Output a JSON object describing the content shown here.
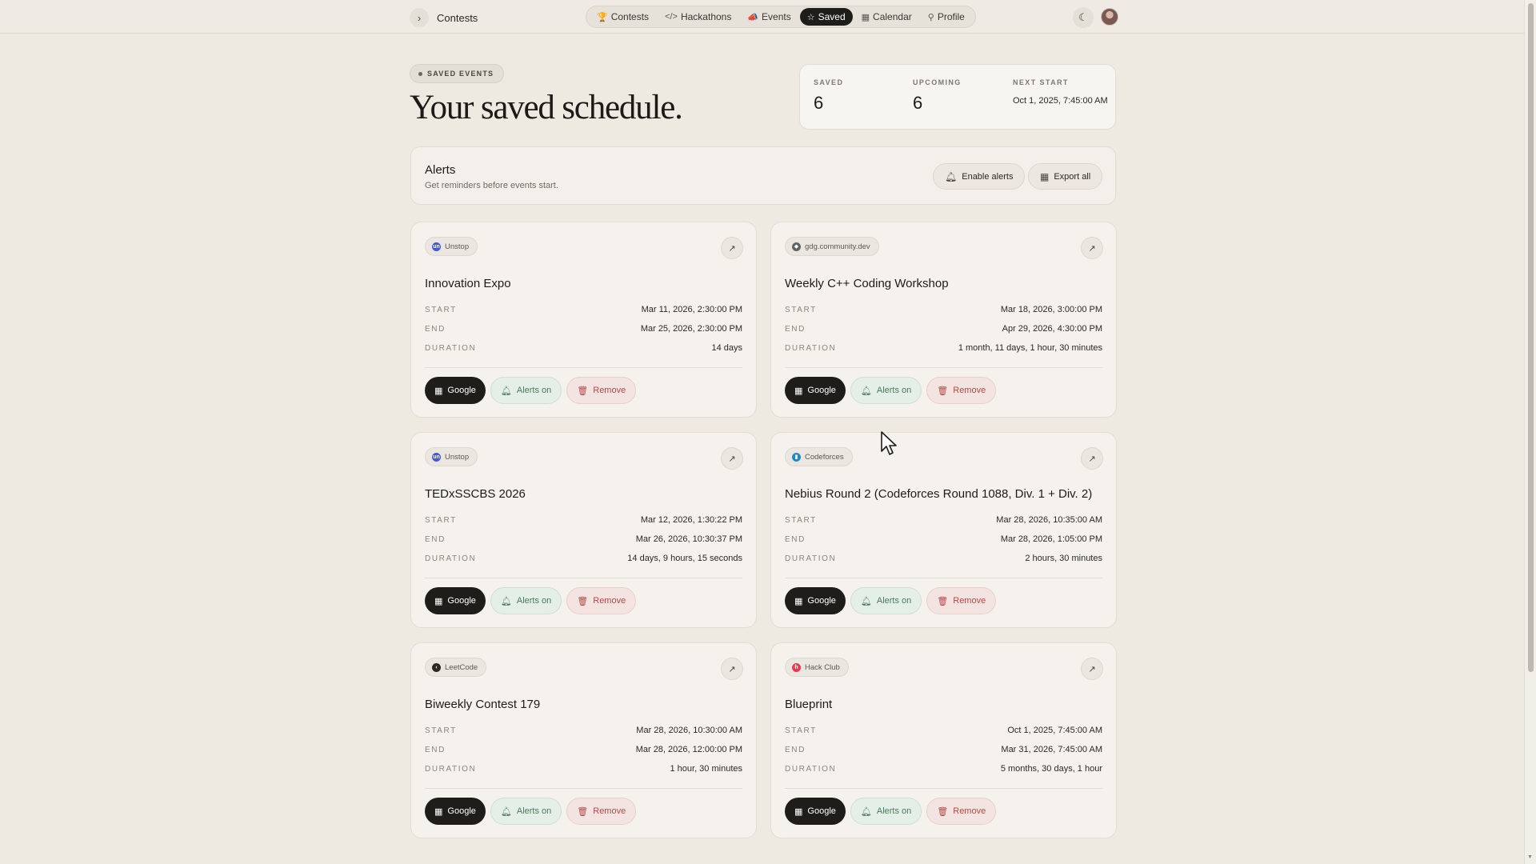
{
  "header": {
    "breadcrumb": "Contests",
    "nav": [
      {
        "icon": "trophy-icon",
        "glyph": "🏆",
        "label": "Contests",
        "active": false
      },
      {
        "icon": "code-icon",
        "glyph": "</>",
        "label": "Hackathons",
        "active": false
      },
      {
        "icon": "megaphone-icon",
        "glyph": "📣",
        "label": "Events",
        "active": false
      },
      {
        "icon": "star-icon",
        "glyph": "☆",
        "label": "Saved",
        "active": true
      },
      {
        "icon": "calendar-icon",
        "glyph": "▦",
        "label": "Calendar",
        "active": false
      },
      {
        "icon": "user-icon",
        "glyph": "⚲",
        "label": "Profile",
        "active": false
      }
    ]
  },
  "page": {
    "badge": "SAVED EVENTS",
    "title": "Your saved schedule."
  },
  "stats": {
    "saved_label": "SAVED",
    "saved_value": "6",
    "upcoming_label": "UPCOMING",
    "upcoming_value": "6",
    "next_label": "NEXT START",
    "next_value": "Oct 1, 2025, 7:45:00 AM"
  },
  "alerts": {
    "title": "Alerts",
    "subtitle": "Get reminders before events start.",
    "enable_label": "Enable alerts",
    "export_label": "Export all"
  },
  "labels": {
    "start": "START",
    "end": "END",
    "duration": "DURATION",
    "google": "Google",
    "alerts_on": "Alerts on",
    "remove": "Remove"
  },
  "cards": [
    {
      "source": "Unstop",
      "source_color": "#3b5bdb",
      "source_glyph": "un",
      "title": "Innovation Expo",
      "start": "Mar 11, 2026, 2:30:00 PM",
      "end": "Mar 25, 2026, 2:30:00 PM",
      "duration": "14 days"
    },
    {
      "source": "gdg.community.dev",
      "source_color": "#5f6368",
      "source_glyph": "◆",
      "title": "Weekly C++ Coding Workshop",
      "start": "Mar 18, 2026, 3:00:00 PM",
      "end": "Apr 29, 2026, 4:30:00 PM",
      "duration": "1 month, 11 days, 1 hour, 30 minutes"
    },
    {
      "source": "Unstop",
      "source_color": "#3b5bdb",
      "source_glyph": "un",
      "title": "TEDxSSCBS 2026",
      "start": "Mar 12, 2026, 1:30:22 PM",
      "end": "Mar 26, 2026, 10:30:37 PM",
      "duration": "14 days, 9 hours, 15 seconds"
    },
    {
      "source": "Codeforces",
      "source_color": "#1f8acb",
      "source_glyph": "▮",
      "title": "Nebius Round 2 (Codeforces Round 1088, Div. 1 + Div. 2)",
      "start": "Mar 28, 2026, 10:35:00 AM",
      "end": "Mar 28, 2026, 1:05:00 PM",
      "duration": "2 hours, 30 minutes"
    },
    {
      "source": "LeetCode",
      "source_color": "#2b2824",
      "source_glyph": "‹",
      "title": "Biweekly Contest 179",
      "start": "Mar 28, 2026, 10:30:00 AM",
      "end": "Mar 28, 2026, 12:00:00 PM",
      "duration": "1 hour, 30 minutes"
    },
    {
      "source": "Hack Club",
      "source_color": "#ec3750",
      "source_glyph": "h",
      "title": "Blueprint",
      "start": "Oct 1, 2025, 7:45:00 AM",
      "end": "Mar 31, 2026, 7:45:00 AM",
      "duration": "5 months, 30 days, 1 hour"
    }
  ]
}
